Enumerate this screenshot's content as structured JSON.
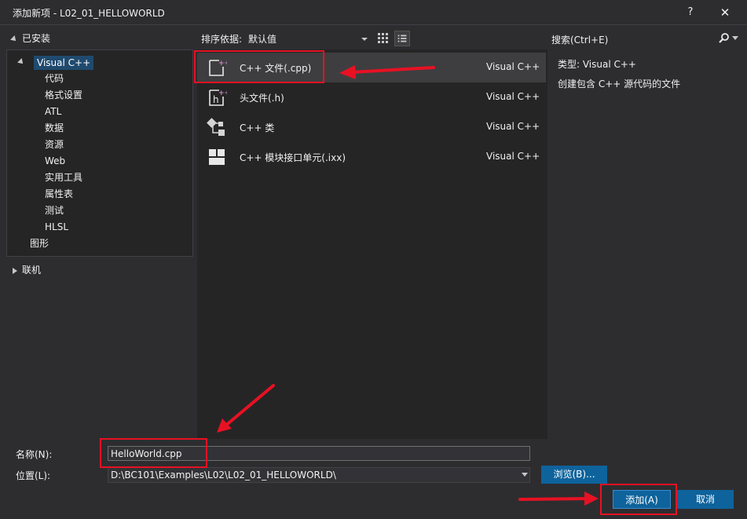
{
  "window": {
    "title": "添加新项 - L02_01_HELLOWORLD",
    "help_label": "?",
    "close_label": "✕"
  },
  "tree": {
    "installed_label": "已安装",
    "root": "Visual C++",
    "children": [
      "代码",
      "格式设置",
      "ATL",
      "数据",
      "资源",
      "Web",
      "实用工具",
      "属性表",
      "测试",
      "HLSL"
    ],
    "sibling": "图形",
    "online_label": "联机"
  },
  "sort": {
    "label": "排序依据:",
    "value": "默认值"
  },
  "items": [
    {
      "name": "C++ 文件(.cpp)",
      "type": "Visual C++",
      "icon": "cpp-file-icon",
      "selected": true
    },
    {
      "name": "头文件(.h)",
      "type": "Visual C++",
      "icon": "header-file-icon",
      "selected": false
    },
    {
      "name": "C++ 类",
      "type": "Visual C++",
      "icon": "class-icon",
      "selected": false
    },
    {
      "name": "C++ 模块接口单元(.ixx)",
      "type": "Visual C++",
      "icon": "module-icon",
      "selected": false
    }
  ],
  "search": {
    "placeholder": "搜索(Ctrl+E)"
  },
  "details": {
    "type_label": "类型: ",
    "type_value": "Visual C++",
    "description": "创建包含 C++ 源代码的文件"
  },
  "form": {
    "name_label": "名称(N):",
    "name_value": "HelloWorld.cpp",
    "location_label": "位置(L):",
    "location_value": "D:\\BC101\\Examples\\L02\\L02_01_HELLOWORLD\\",
    "browse_label": "浏览(B)...",
    "add_label": "添加(A)",
    "cancel_label": "取消"
  },
  "colors": {
    "accent": "#0e639c",
    "annotation": "#e81123",
    "background": "#2d2d30",
    "panel": "#252526"
  }
}
